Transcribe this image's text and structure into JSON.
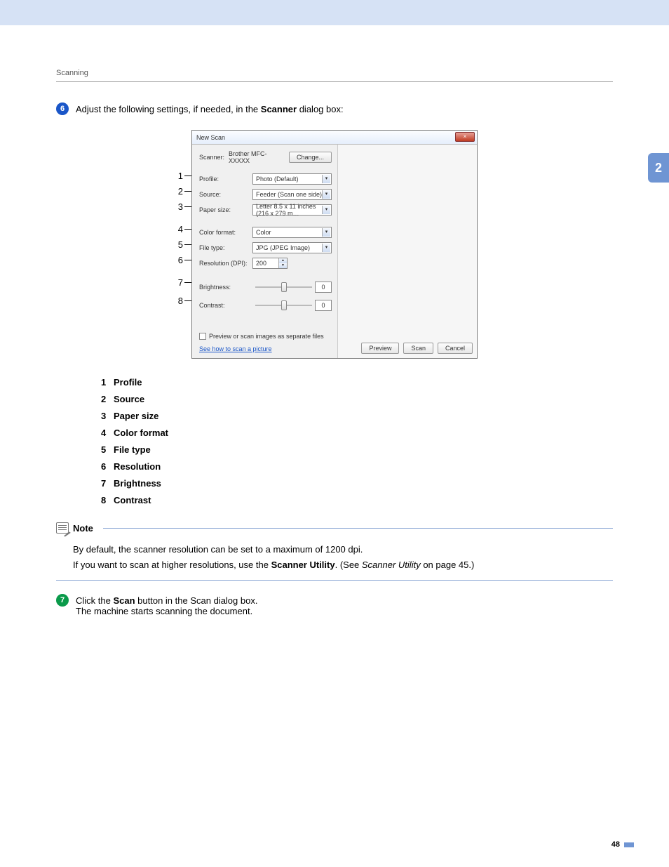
{
  "header": {
    "section": "Scanning"
  },
  "side_tab": "2",
  "step6": {
    "num": "6",
    "text_before": "Adjust the following settings, if needed, in the ",
    "text_bold": "Scanner",
    "text_after": " dialog box:"
  },
  "dialog": {
    "title": "New Scan",
    "close": "×",
    "scanner_label": "Scanner:",
    "scanner_value": "Brother MFC- XXXXX",
    "change_btn": "Change...",
    "fields": [
      {
        "label": "Profile:",
        "value": "Photo (Default)"
      },
      {
        "label": "Source:",
        "value": "Feeder (Scan one side)"
      },
      {
        "label": "Paper size:",
        "value": "Letter 8.5 x 11 inches (216 x 279 m…"
      },
      {
        "label": "Color format:",
        "value": "Color"
      },
      {
        "label": "File type:",
        "value": "JPG (JPEG Image)"
      }
    ],
    "resolution_label": "Resolution (DPI):",
    "resolution_value": "200",
    "brightness_label": "Brightness:",
    "brightness_value": "0",
    "contrast_label": "Contrast:",
    "contrast_value": "0",
    "checkbox": "Preview or scan images as separate files",
    "link": "See how to scan a picture",
    "preview_btn": "Preview",
    "scan_btn": "Scan",
    "cancel_btn": "Cancel"
  },
  "callout_nums": [
    "1",
    "2",
    "3",
    "4",
    "5",
    "6",
    "7",
    "8"
  ],
  "legend": [
    {
      "n": "1",
      "label": "Profile"
    },
    {
      "n": "2",
      "label": "Source"
    },
    {
      "n": "3",
      "label": "Paper size"
    },
    {
      "n": "4",
      "label": "Color format"
    },
    {
      "n": "5",
      "label": "File type"
    },
    {
      "n": "6",
      "label": "Resolution"
    },
    {
      "n": "7",
      "label": "Brightness"
    },
    {
      "n": "8",
      "label": "Contrast"
    }
  ],
  "note": {
    "title": "Note",
    "line1": "By default, the scanner resolution can be set to a maximum of 1200 dpi.",
    "line2_a": "If you want to scan at higher resolutions, use the ",
    "line2_bold": "Scanner Utility",
    "line2_b": ". (See ",
    "line2_italic": "Scanner Utility",
    "line2_c": " on page 45.)"
  },
  "step7": {
    "num": "7",
    "line1_a": "Click the ",
    "line1_bold": "Scan",
    "line1_b": " button in the Scan dialog box.",
    "line2": "The machine starts scanning the document."
  },
  "footer": {
    "page": "48"
  }
}
